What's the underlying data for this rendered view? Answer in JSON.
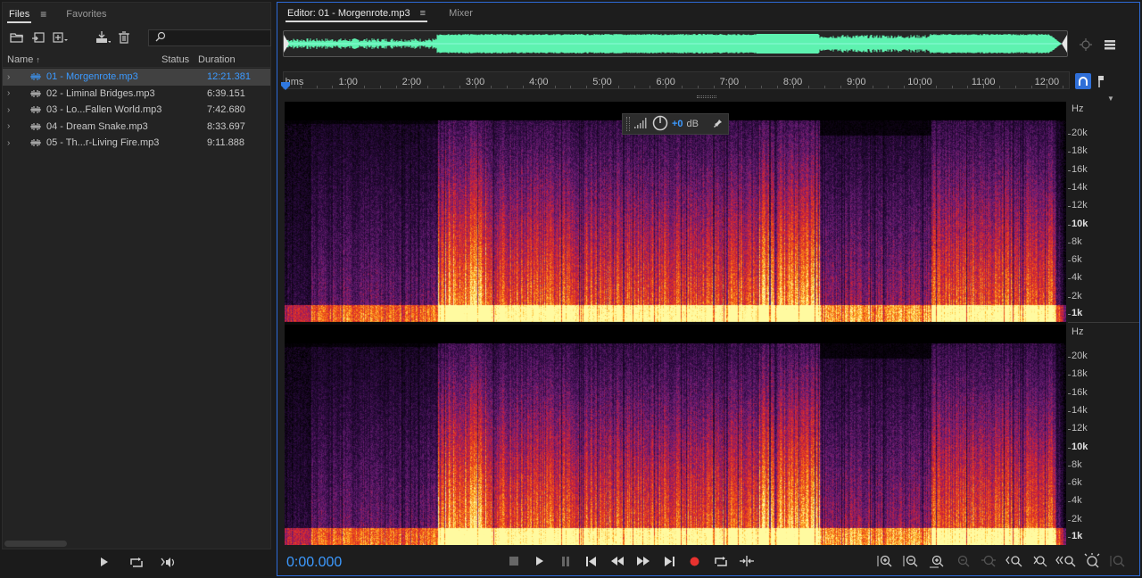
{
  "files_panel": {
    "tab_files": "Files",
    "tab_favorites": "Favorites",
    "search_placeholder": "",
    "columns": {
      "name": "Name",
      "status": "Status",
      "duration": "Duration"
    },
    "files": [
      {
        "name": "01 - Morgenrote.mp3",
        "duration": "12:21.381",
        "selected": true
      },
      {
        "name": "02 - Liminal Bridges.mp3",
        "duration": "6:39.151",
        "selected": false
      },
      {
        "name": "03 - Lo...Fallen World.mp3",
        "duration": "7:42.680",
        "selected": false
      },
      {
        "name": "04 - Dream Snake.mp3",
        "duration": "8:33.697",
        "selected": false
      },
      {
        "name": "05 - Th...r-Living Fire.mp3",
        "duration": "9:11.888",
        "selected": false
      }
    ]
  },
  "editor": {
    "tab_editor": "Editor: 01 - Morgenrote.mp3",
    "tab_mixer": "Mixer",
    "ruler_labels": [
      "hms",
      "1:00",
      "2:00",
      "3:00",
      "4:00",
      "5:00",
      "6:00",
      "7:00",
      "8:00",
      "9:00",
      "10:00",
      "11:00",
      "12:00"
    ],
    "hz_axis": {
      "unit": "Hz",
      "labels": [
        {
          "text": "20k",
          "khz": 20,
          "bold": false
        },
        {
          "text": "18k",
          "khz": 18,
          "bold": false
        },
        {
          "text": "16k",
          "khz": 16,
          "bold": false
        },
        {
          "text": "14k",
          "khz": 14,
          "bold": false
        },
        {
          "text": "12k",
          "khz": 12,
          "bold": false
        },
        {
          "text": "10k",
          "khz": 10,
          "bold": true
        },
        {
          "text": "8k",
          "khz": 8,
          "bold": false
        },
        {
          "text": "6k",
          "khz": 6,
          "bold": false
        },
        {
          "text": "4k",
          "khz": 4,
          "bold": false
        },
        {
          "text": "2k",
          "khz": 2,
          "bold": false
        },
        {
          "text": "1k",
          "khz": 1,
          "bold": true
        }
      ]
    },
    "hud": {
      "gain": "+0",
      "unit": "dB"
    },
    "time_display": "0:00.000",
    "colors": {
      "accent": "#3c9aff",
      "overview_wave": "#5ef2b0",
      "record": "#e8322f",
      "panel_border": "#2d6ad8"
    }
  },
  "icons": {
    "files_toolbar": [
      "open-file-icon",
      "import-icon",
      "new-file-icon",
      "insert-icon",
      "delete-icon"
    ],
    "files_transport": [
      "play-icon",
      "loop-icon",
      "autoplay-icon"
    ],
    "transport": [
      "stop-icon",
      "play-icon",
      "pause-icon",
      "skip-back-icon",
      "rewind-icon",
      "fast-forward-icon",
      "skip-forward-icon",
      "record-icon",
      "loop-icon",
      "skip-selection-icon"
    ],
    "zoom": [
      "zoom-in-amplitude-icon",
      "zoom-out-amplitude-icon",
      "zoom-in-time-icon",
      "zoom-out-time-icon",
      "zoom-out-full-icon",
      "zoom-in-left-icon",
      "zoom-in-right-icon",
      "zoom-selection-icon",
      "zoom-in-spectral-icon",
      "zoom-out-spectral-icon"
    ]
  }
}
